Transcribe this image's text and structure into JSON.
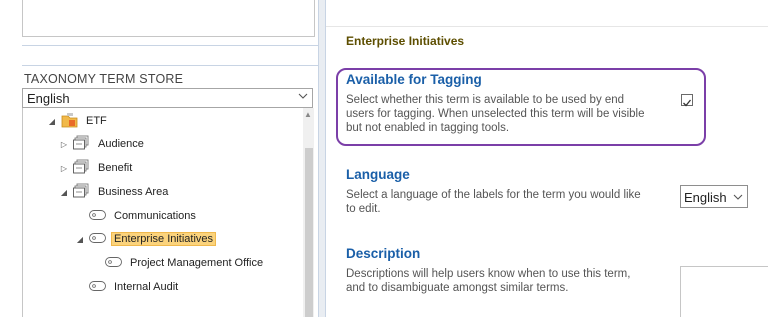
{
  "left_panel": {
    "store_label": "TAXONOMY TERM STORE",
    "language_select": {
      "value": "English",
      "icon": "chevron-down-icon"
    }
  },
  "tree": {
    "nodes": [
      {
        "label": "ETF",
        "arrow": "◢",
        "icon": "term-group-icon",
        "selected": false
      },
      {
        "label": "Audience",
        "arrow": "▷",
        "icon": "term-set-icon",
        "selected": false
      },
      {
        "label": "Benefit",
        "arrow": "▷",
        "icon": "term-set-icon",
        "selected": false
      },
      {
        "label": "Business Area",
        "arrow": "◢",
        "icon": "term-set-icon",
        "selected": false
      },
      {
        "label": "Communications",
        "arrow": "",
        "icon": "term-icon",
        "selected": false
      },
      {
        "label": "Enterprise Initiatives",
        "arrow": "◢",
        "icon": "term-icon",
        "selected": true
      },
      {
        "label": "Project Management Office",
        "arrow": "",
        "icon": "term-icon",
        "selected": false
      },
      {
        "label": "Internal Audit",
        "arrow": "",
        "icon": "term-icon",
        "selected": false
      }
    ]
  },
  "right_panel": {
    "term_title": "Enterprise Initiatives",
    "tagging": {
      "title": "Available for Tagging",
      "desc": "Select whether this term is available to be used by end users for tagging. When unselected this term will be visible but not enabled in tagging tools.",
      "checked": true
    },
    "language": {
      "title": "Language",
      "desc": "Select a language of the labels for the term you would like to edit.",
      "value": "English"
    },
    "description": {
      "title": "Description",
      "desc": "Descriptions will help users know when to use this term, and to disambiguate amongst similar terms."
    }
  },
  "colors": {
    "accent": "#1a5fa8",
    "highlight_border": "#7b3fa8",
    "selection": "#fbd37c"
  }
}
